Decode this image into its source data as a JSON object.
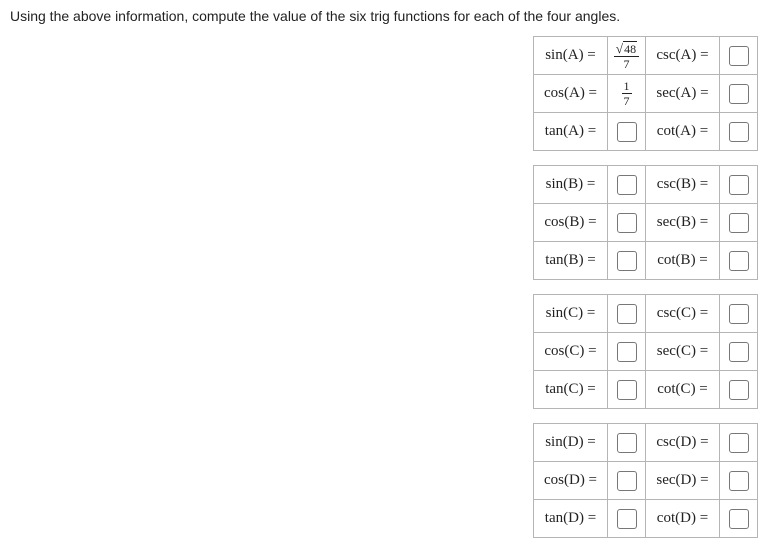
{
  "prompt": "Using the above information, compute the value of the six trig functions for each of the four angles.",
  "angles": [
    "A",
    "B",
    "C",
    "D"
  ],
  "funcs": {
    "left": [
      "sin",
      "cos",
      "tan"
    ],
    "right": [
      "csc",
      "sec",
      "cot"
    ]
  },
  "prefilled": {
    "A": {
      "sin": {
        "type": "frac",
        "num_sqrt": "48",
        "den": "7"
      },
      "cos": {
        "type": "frac",
        "num": "1",
        "den": "7"
      }
    }
  }
}
